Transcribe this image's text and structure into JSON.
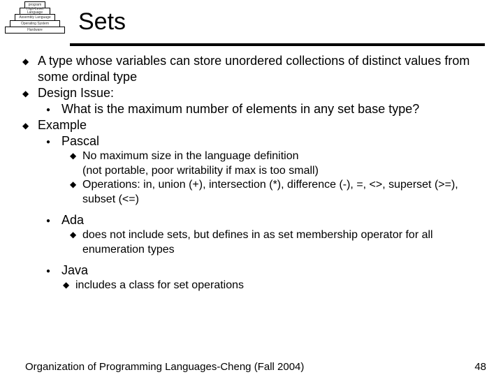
{
  "header": {
    "title": "Sets"
  },
  "pyramid": {
    "l1": "program",
    "l2": "High-Level Language",
    "l3": "Assembly Language",
    "l4": "Operating System",
    "l5": "Hardware"
  },
  "b1": "A type whose variables can store unordered collections of distinct values from some ordinal type",
  "b2": "Design Issue:",
  "b2a": "What is the maximum number of elements in any set base type?",
  "b3": "Example",
  "b3a": "Pascal",
  "b3a1": "No maximum size in the language definition",
  "b3a1c": "(not portable, poor writability if max is too small)",
  "b3a2": "Operations:  in, union (+), intersection (*), difference (-), =, <>, superset (>=), subset (<=)",
  "b3b": "Ada",
  "b3b1": "does not include sets, but defines in as set membership operator for all enumeration types",
  "b3c": "Java",
  "b3c1": "includes a class for set operations",
  "footer": {
    "text": "Organization of Programming Languages-Cheng (Fall 2004)",
    "page": "48"
  }
}
